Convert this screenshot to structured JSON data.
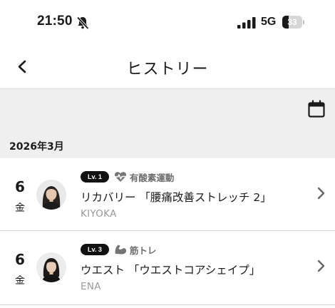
{
  "status_bar": {
    "time": "21:50",
    "network": "5G",
    "battery_level": "33",
    "battery_fraction": 0.33,
    "silent_icon": "bell-slash-icon",
    "signal_icon": "cellular-signal-icon"
  },
  "nav": {
    "title": "ヒストリー",
    "back_icon": "chevron-left-icon"
  },
  "toolbar": {
    "calendar_icon": "calendar-icon"
  },
  "month": "2026年3月",
  "entries": [
    {
      "day": "6",
      "weekday": "金",
      "level": "Lv. 1",
      "category_icon": "heartbeat-icon",
      "category": "有酸素運動",
      "title": "リカバリー 「腰痛改善ストレッチ 2」",
      "instructor": "KIYOKA"
    },
    {
      "day": "6",
      "weekday": "金",
      "level": "Lv. 3",
      "category_icon": "flexed-arm-icon",
      "category": "筋トレ",
      "title": "ウエスト 「ウエストコアシェイプ」",
      "instructor": "ENA"
    }
  ],
  "colors": {
    "accent_dark": "#111111",
    "background_band": "#efefef",
    "muted_text": "#9a9a9a"
  }
}
